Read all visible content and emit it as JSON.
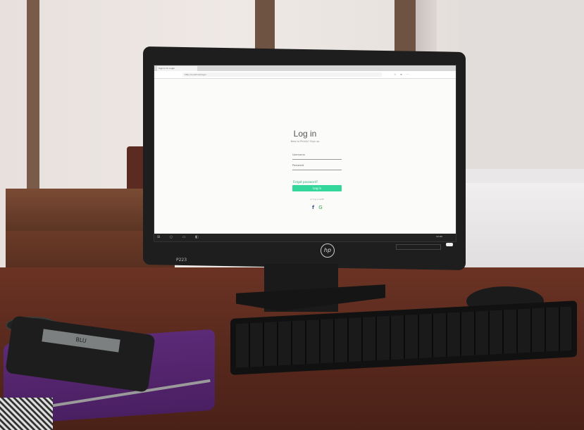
{
  "browser": {
    "tab_title": "Sign in to Login",
    "address": "http://localhost/login",
    "toolbar_icons": "☆ ≡ ⋯"
  },
  "login": {
    "title": "Log in",
    "subtitle": "New to Pickify? Sign up",
    "username_label": "Username",
    "password_label": "Password",
    "forgot_label": "Forgot password?",
    "button_label": "Log in",
    "or_label": "or log in with",
    "social_facebook": "f",
    "social_google": "G"
  },
  "taskbar": {
    "icons": "⊞ ○ ▭ ◧",
    "clock": "12:00"
  },
  "monitor": {
    "model": "P223",
    "logo": "hp"
  },
  "tablet": {
    "brand": "BLU"
  }
}
